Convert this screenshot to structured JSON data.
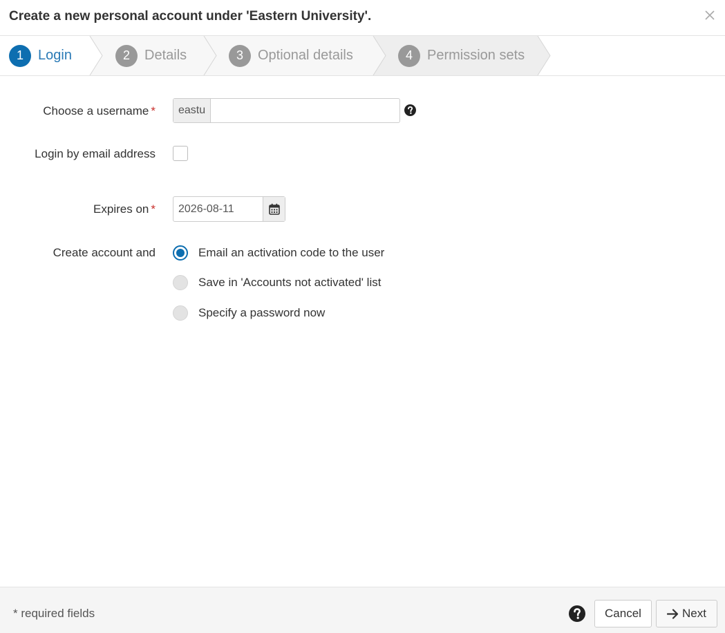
{
  "dialog": {
    "title": "Create a new personal account under 'Eastern University'."
  },
  "wizard": {
    "steps": [
      {
        "number": "1",
        "label": "Login",
        "active": true
      },
      {
        "number": "2",
        "label": "Details",
        "active": false
      },
      {
        "number": "3",
        "label": "Optional details",
        "active": false
      },
      {
        "number": "4",
        "label": "Permission sets",
        "active": false
      }
    ]
  },
  "form": {
    "username": {
      "label": "Choose a username",
      "required_marker": "*",
      "prefix": "eastu",
      "value": ""
    },
    "login_by_email": {
      "label": "Login by email address",
      "checked": false
    },
    "expires_on": {
      "label": "Expires on",
      "required_marker": "*",
      "value": "2026-08-11"
    },
    "create_account": {
      "label": "Create account and",
      "options": [
        {
          "label": "Email an activation code to the user",
          "checked": true
        },
        {
          "label": "Save in 'Accounts not activated' list",
          "checked": false
        },
        {
          "label": "Specify a password now",
          "checked": false
        }
      ]
    }
  },
  "footer": {
    "required_note": "* required fields",
    "cancel_label": "Cancel",
    "next_label": "Next"
  },
  "colors": {
    "accent": "#0d6eb0",
    "inactive_step": "#999999",
    "required": "#c9302c"
  },
  "icons": {
    "close": "close-icon",
    "help": "question-circle-icon",
    "calendar": "calendar-icon",
    "next": "arrow-right-icon"
  }
}
